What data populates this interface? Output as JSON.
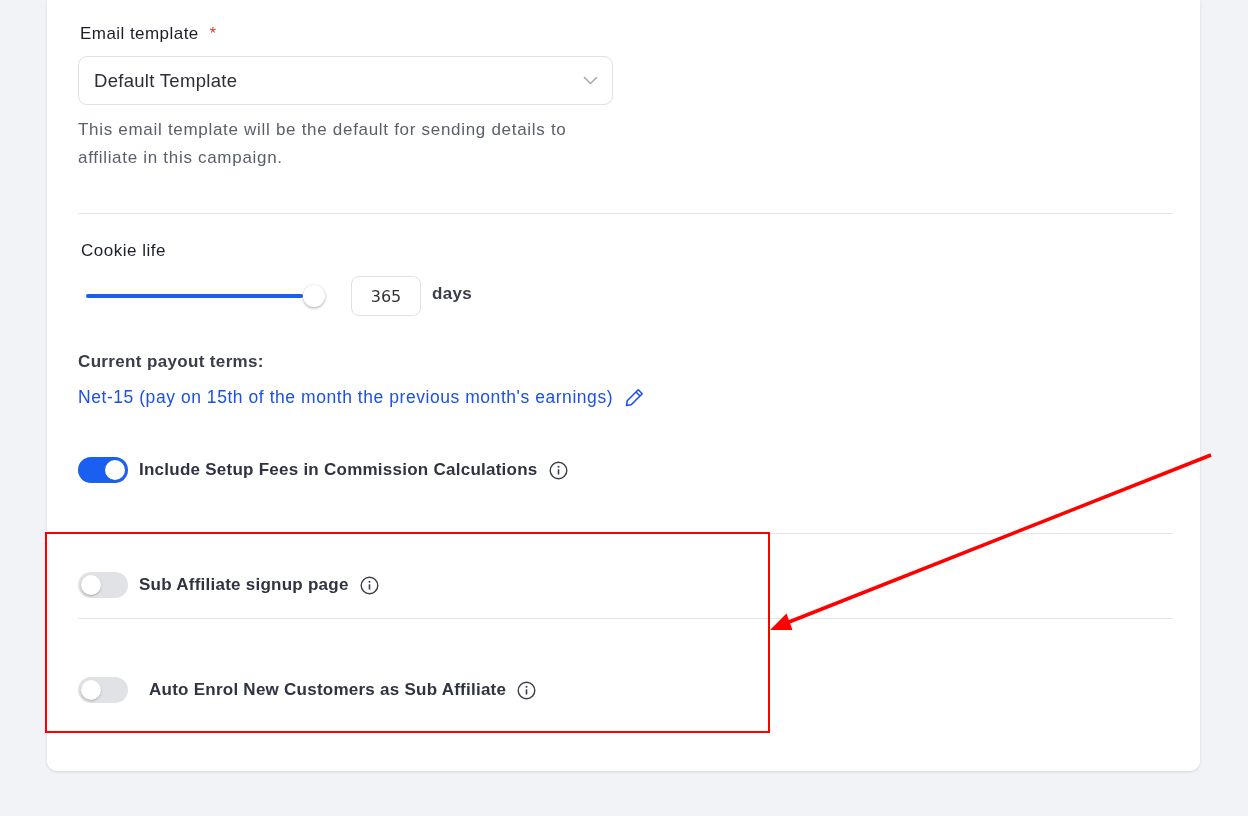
{
  "email_template": {
    "label": "Email template",
    "required_mark": "*",
    "value": "Default Template",
    "help": "This email template will be the default for sending details to affiliate in this campaign."
  },
  "cookie_life": {
    "label": "Cookie life",
    "level": 1,
    "value": "365",
    "unit": "days"
  },
  "payout_terms": {
    "label": "Current payout terms:",
    "value": "Net-15 (pay on 15th of the month the previous month's earnings)"
  },
  "toggles": [
    {
      "label": "Include Setup Fees in Commission Calculations",
      "on": true
    },
    {
      "label": "Sub Affiliate signup page",
      "on": false
    },
    {
      "label": "Auto Enrol New Customers as Sub Affiliate",
      "on": false
    }
  ],
  "annotations": {
    "highlight_frame": true,
    "arrow": true
  }
}
